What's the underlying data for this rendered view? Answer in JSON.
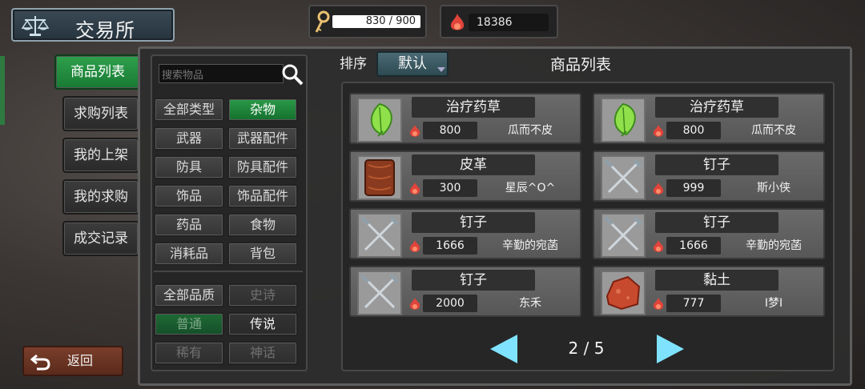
{
  "title": "交易所",
  "resources": {
    "key_value": "830 / 900",
    "gold_value": "18386"
  },
  "tabs": [
    "商品列表",
    "求购列表",
    "我的上架",
    "我的求购",
    "成交记录"
  ],
  "back_label": "返回",
  "search": {
    "placeholder": "搜索物品"
  },
  "categories": [
    "全部类型",
    "杂物",
    "武器",
    "武器配件",
    "防具",
    "防具配件",
    "饰品",
    "饰品配件",
    "药品",
    "食物",
    "消耗品",
    "背包"
  ],
  "qualities": [
    "全部品质",
    "史诗",
    "普通",
    "传说",
    "稀有",
    "神话"
  ],
  "sort": {
    "label": "排序",
    "value": "默认"
  },
  "list_title": "商品列表",
  "items": [
    {
      "name": "治疗药草",
      "price": "800",
      "seller": "瓜而不皮",
      "icon": "herb-leaf-icon"
    },
    {
      "name": "治疗药草",
      "price": "800",
      "seller": "瓜而不皮",
      "icon": "herb-leaf-icon"
    },
    {
      "name": "皮革",
      "price": "300",
      "seller": "星辰^O^",
      "icon": "leather-icon"
    },
    {
      "name": "钉子",
      "price": "999",
      "seller": "斯小侠",
      "icon": "nails-icon"
    },
    {
      "name": "钉子",
      "price": "1666",
      "seller": "辛勤的宛菡",
      "icon": "nails-icon"
    },
    {
      "name": "钉子",
      "price": "1666",
      "seller": "辛勤的宛菡",
      "icon": "nails-icon"
    },
    {
      "name": "钉子",
      "price": "2000",
      "seller": "东禾",
      "icon": "nails-icon"
    },
    {
      "name": "黏土",
      "price": "777",
      "seller": "I梦I",
      "icon": "clay-icon"
    }
  ],
  "pager": {
    "text": "2 / 5"
  }
}
